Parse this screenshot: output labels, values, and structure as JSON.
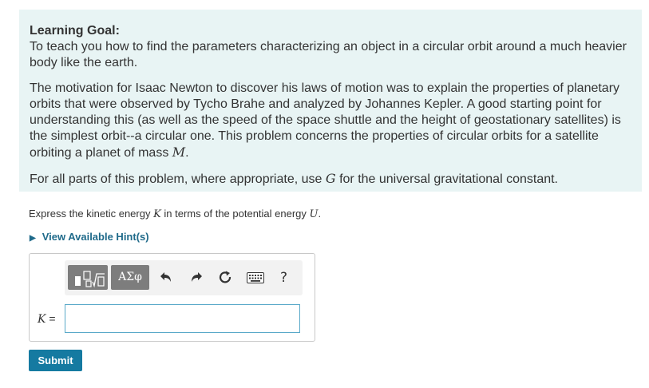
{
  "learning_goal": {
    "title": "Learning Goal:",
    "intro": "To teach you how to find the parameters characterizing an object in a circular orbit around a much heavier body like the earth.",
    "motivation_text": "The motivation for Isaac Newton to discover his laws of motion was to explain the properties of planetary orbits that were observed by Tycho Brahe and analyzed by Johannes Kepler. A good starting point for understanding this (as well as the speed of the space shuttle and the height of geostationary satellites) is the simplest orbit--a circular one. This problem concerns the properties of circular orbits for a satellite orbiting a planet of mass ",
    "motivation_var": "M",
    "motivation_end": ".",
    "constant_text": "For all parts of this problem, where appropriate, use ",
    "constant_var": "G",
    "constant_end": " for the universal gravitational constant."
  },
  "question": {
    "text_before": "Express the kinetic energy ",
    "var_k": "K",
    "text_middle": " in terms of the potential energy ",
    "var_u": "U",
    "text_end": "."
  },
  "hint": {
    "label": "View Available Hint(s)"
  },
  "toolbar": {
    "templates_icon": "templates-icon",
    "symbols_label": "ΑΣφ",
    "undo_icon": "undo-icon",
    "redo_icon": "redo-icon",
    "reset_icon": "reset-icon",
    "keyboard_icon": "keyboard-icon",
    "help_label": "?"
  },
  "answer": {
    "variable_label": "K",
    "equals": "=",
    "input_value": ""
  },
  "submit": {
    "label": "Submit"
  },
  "colors": {
    "goal_background": "#e8f4f4",
    "link": "#1f6a8a",
    "submit_background": "#157aa1",
    "toolbar_button": "#7d7d7d",
    "input_border": "#5aa9c9"
  }
}
